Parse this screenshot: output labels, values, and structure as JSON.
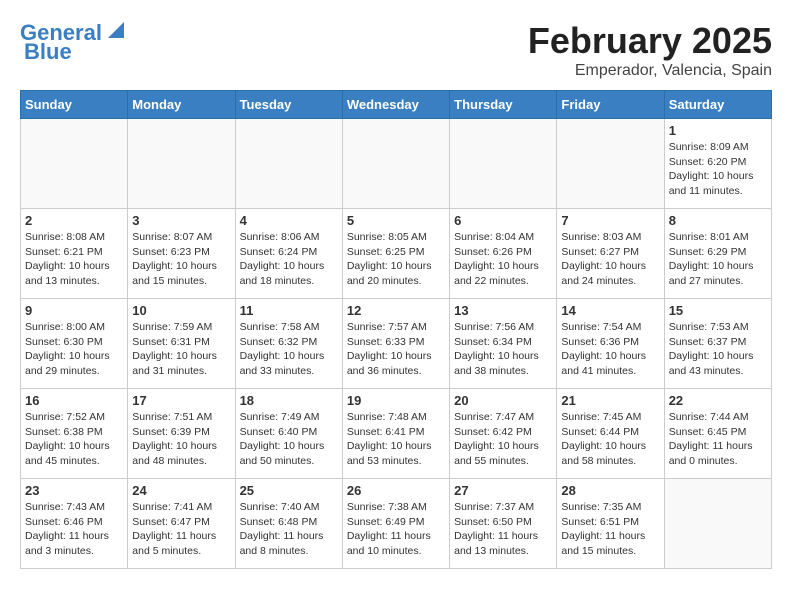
{
  "header": {
    "logo_general": "General",
    "logo_blue": "Blue",
    "month_title": "February 2025",
    "location": "Emperador, Valencia, Spain"
  },
  "weekdays": [
    "Sunday",
    "Monday",
    "Tuesday",
    "Wednesday",
    "Thursday",
    "Friday",
    "Saturday"
  ],
  "weeks": [
    [
      {
        "day": "",
        "info": ""
      },
      {
        "day": "",
        "info": ""
      },
      {
        "day": "",
        "info": ""
      },
      {
        "day": "",
        "info": ""
      },
      {
        "day": "",
        "info": ""
      },
      {
        "day": "",
        "info": ""
      },
      {
        "day": "1",
        "info": "Sunrise: 8:09 AM\nSunset: 6:20 PM\nDaylight: 10 hours\nand 11 minutes."
      }
    ],
    [
      {
        "day": "2",
        "info": "Sunrise: 8:08 AM\nSunset: 6:21 PM\nDaylight: 10 hours\nand 13 minutes."
      },
      {
        "day": "3",
        "info": "Sunrise: 8:07 AM\nSunset: 6:23 PM\nDaylight: 10 hours\nand 15 minutes."
      },
      {
        "day": "4",
        "info": "Sunrise: 8:06 AM\nSunset: 6:24 PM\nDaylight: 10 hours\nand 18 minutes."
      },
      {
        "day": "5",
        "info": "Sunrise: 8:05 AM\nSunset: 6:25 PM\nDaylight: 10 hours\nand 20 minutes."
      },
      {
        "day": "6",
        "info": "Sunrise: 8:04 AM\nSunset: 6:26 PM\nDaylight: 10 hours\nand 22 minutes."
      },
      {
        "day": "7",
        "info": "Sunrise: 8:03 AM\nSunset: 6:27 PM\nDaylight: 10 hours\nand 24 minutes."
      },
      {
        "day": "8",
        "info": "Sunrise: 8:01 AM\nSunset: 6:29 PM\nDaylight: 10 hours\nand 27 minutes."
      }
    ],
    [
      {
        "day": "9",
        "info": "Sunrise: 8:00 AM\nSunset: 6:30 PM\nDaylight: 10 hours\nand 29 minutes."
      },
      {
        "day": "10",
        "info": "Sunrise: 7:59 AM\nSunset: 6:31 PM\nDaylight: 10 hours\nand 31 minutes."
      },
      {
        "day": "11",
        "info": "Sunrise: 7:58 AM\nSunset: 6:32 PM\nDaylight: 10 hours\nand 33 minutes."
      },
      {
        "day": "12",
        "info": "Sunrise: 7:57 AM\nSunset: 6:33 PM\nDaylight: 10 hours\nand 36 minutes."
      },
      {
        "day": "13",
        "info": "Sunrise: 7:56 AM\nSunset: 6:34 PM\nDaylight: 10 hours\nand 38 minutes."
      },
      {
        "day": "14",
        "info": "Sunrise: 7:54 AM\nSunset: 6:36 PM\nDaylight: 10 hours\nand 41 minutes."
      },
      {
        "day": "15",
        "info": "Sunrise: 7:53 AM\nSunset: 6:37 PM\nDaylight: 10 hours\nand 43 minutes."
      }
    ],
    [
      {
        "day": "16",
        "info": "Sunrise: 7:52 AM\nSunset: 6:38 PM\nDaylight: 10 hours\nand 45 minutes."
      },
      {
        "day": "17",
        "info": "Sunrise: 7:51 AM\nSunset: 6:39 PM\nDaylight: 10 hours\nand 48 minutes."
      },
      {
        "day": "18",
        "info": "Sunrise: 7:49 AM\nSunset: 6:40 PM\nDaylight: 10 hours\nand 50 minutes."
      },
      {
        "day": "19",
        "info": "Sunrise: 7:48 AM\nSunset: 6:41 PM\nDaylight: 10 hours\nand 53 minutes."
      },
      {
        "day": "20",
        "info": "Sunrise: 7:47 AM\nSunset: 6:42 PM\nDaylight: 10 hours\nand 55 minutes."
      },
      {
        "day": "21",
        "info": "Sunrise: 7:45 AM\nSunset: 6:44 PM\nDaylight: 10 hours\nand 58 minutes."
      },
      {
        "day": "22",
        "info": "Sunrise: 7:44 AM\nSunset: 6:45 PM\nDaylight: 11 hours\nand 0 minutes."
      }
    ],
    [
      {
        "day": "23",
        "info": "Sunrise: 7:43 AM\nSunset: 6:46 PM\nDaylight: 11 hours\nand 3 minutes."
      },
      {
        "day": "24",
        "info": "Sunrise: 7:41 AM\nSunset: 6:47 PM\nDaylight: 11 hours\nand 5 minutes."
      },
      {
        "day": "25",
        "info": "Sunrise: 7:40 AM\nSunset: 6:48 PM\nDaylight: 11 hours\nand 8 minutes."
      },
      {
        "day": "26",
        "info": "Sunrise: 7:38 AM\nSunset: 6:49 PM\nDaylight: 11 hours\nand 10 minutes."
      },
      {
        "day": "27",
        "info": "Sunrise: 7:37 AM\nSunset: 6:50 PM\nDaylight: 11 hours\nand 13 minutes."
      },
      {
        "day": "28",
        "info": "Sunrise: 7:35 AM\nSunset: 6:51 PM\nDaylight: 11 hours\nand 15 minutes."
      },
      {
        "day": "",
        "info": ""
      }
    ]
  ]
}
